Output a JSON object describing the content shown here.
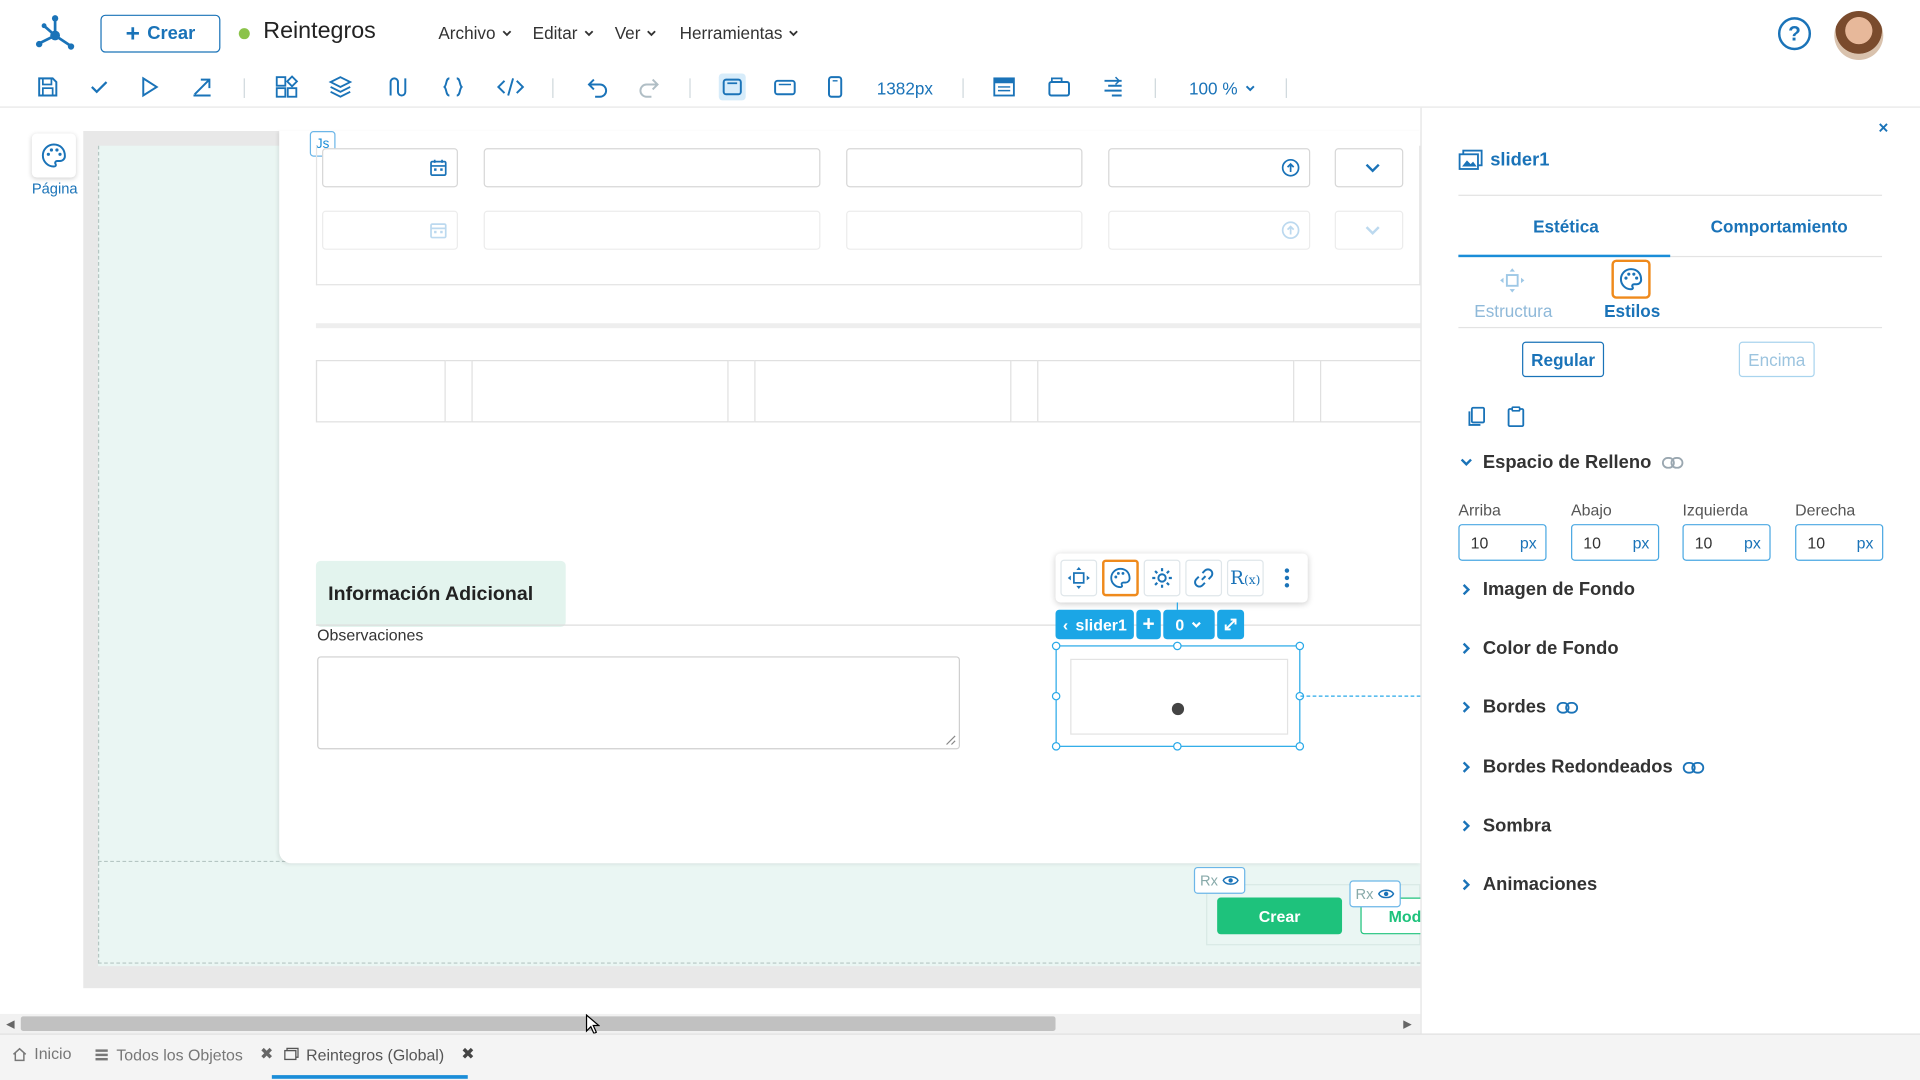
{
  "header": {
    "create_label": "Crear",
    "doc_title": "Reintegros",
    "menus": [
      "Archivo",
      "Editar",
      "Ver",
      "Herramientas"
    ],
    "help_label": "?"
  },
  "toolbar": {
    "width_value": "1382px",
    "zoom": "100 %"
  },
  "left_sidebar": {
    "page_label": "Página"
  },
  "canvas": {
    "js_tag": "Js",
    "section_title": "Información Adicional",
    "observations_label": "Observaciones",
    "selected_component": "slider1",
    "selected_index": "0",
    "slider_value": 0,
    "create_button": "Crear",
    "modify_button": "Mod",
    "rx_label": "Rx"
  },
  "panel": {
    "title": "slider1",
    "close_symbol": "×",
    "tabs": [
      "Estética",
      "Comportamiento"
    ],
    "subtabs": [
      "Estructura",
      "Estilos"
    ],
    "states": [
      "Regular",
      "Encima"
    ],
    "padding_section": "Espacio de Relleno",
    "padding_fields": [
      {
        "label": "Arriba",
        "value": "10",
        "unit": "px"
      },
      {
        "label": "Abajo",
        "value": "10",
        "unit": "px"
      },
      {
        "label": "Izquierda",
        "value": "10",
        "unit": "px"
      },
      {
        "label": "Derecha",
        "value": "10",
        "unit": "px"
      }
    ],
    "sections": [
      "Imagen de Fondo",
      "Color de Fondo",
      "Bordes",
      "Bordes Redondeados",
      "Sombra",
      "Animaciones"
    ]
  },
  "bottom_tabs": [
    "Inicio",
    "Todos los Objetos",
    "Reintegros (Global)"
  ],
  "colors": {
    "primary": "#1a73b8",
    "accent": "#1a8dd8",
    "selected_outline": "#ef8a1c",
    "green": "#1ec27c",
    "canvas_teal": "#eaf6f3"
  }
}
